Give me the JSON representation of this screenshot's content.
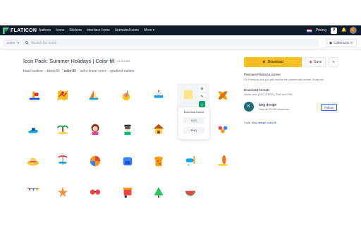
{
  "nav": {
    "logo_text": "FLATICON",
    "links": [
      "Authors",
      "Icons",
      "Stickers",
      "Interface Icons",
      "Animated icons",
      "More ▾"
    ],
    "pricing": "Pricing"
  },
  "search": {
    "category": "Icons",
    "placeholder": "Search for icons",
    "collections": "Collections",
    "collections_count": "0"
  },
  "pack": {
    "title": "Icon Pack: Summer Holidays | Color fill",
    "count": "21 ICONS",
    "styles": [
      "black outline",
      "black fill",
      "color fill",
      "color linear color",
      "gradient outline"
    ],
    "active_style": "color fill"
  },
  "popup": {
    "title": "Download asset",
    "svg_label": "SVG",
    "png_label": "PNG"
  },
  "sidebar": {
    "download_label": "Download",
    "save_label": "Save",
    "license_title": "Premium Flaticon License",
    "license_text": "Go Premium and you will receive the commercial license. More info",
    "license_link": "More info",
    "formats_title": "Download formats",
    "formats_text": "Vector icon (SVG & EPS), PNG and PSD",
    "author_name": "king design",
    "author_sub": "View all 25,539 resources",
    "follow_label": "Follow",
    "style_prefix": "Style:",
    "style_value": "king design color fill"
  },
  "colors": {
    "nav_bg": "#0f1a2b",
    "accent_yellow": "#fcbf22",
    "link_blue": "#1e40af",
    "green": "#0e9f6e"
  }
}
